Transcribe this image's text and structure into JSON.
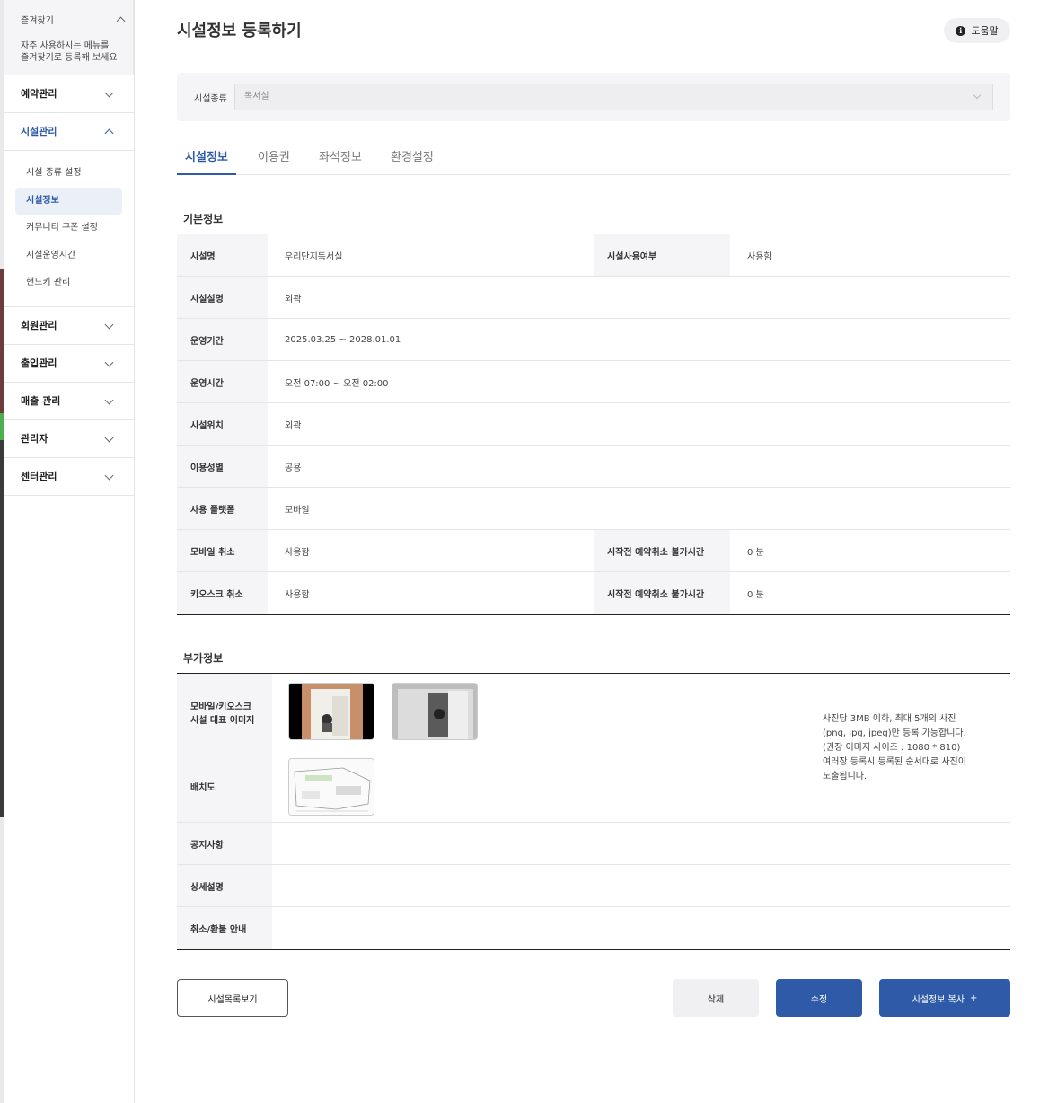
{
  "sidebar": {
    "favorites": {
      "title": "즐겨찾기",
      "desc_line1": "자주 사용하시는 메뉴를",
      "desc_line2": "즐겨찾기로 등록해 보세요!"
    },
    "menus": [
      {
        "label": "예약관리"
      },
      {
        "label": "시설관리"
      },
      {
        "label": "회원관리"
      },
      {
        "label": "출입관리"
      },
      {
        "label": "매출 관리"
      },
      {
        "label": "관리자"
      },
      {
        "label": "센터관리"
      }
    ],
    "submenu": [
      {
        "label": "시설 종류 설정"
      },
      {
        "label": "시설정보"
      },
      {
        "label": "커뮤니티 쿠폰 설정"
      },
      {
        "label": "시설운영시간"
      },
      {
        "label": "핸드키 관리"
      }
    ]
  },
  "header": {
    "title": "시설정보 등록하기",
    "help_label": "도움말"
  },
  "facility_type": {
    "label": "시설종류",
    "value": "독서실"
  },
  "tabs": [
    {
      "label": "시설정보"
    },
    {
      "label": "이용권"
    },
    {
      "label": "좌석정보"
    },
    {
      "label": "환경설정"
    }
  ],
  "basic": {
    "title": "기본정보",
    "name_label": "시설명",
    "name_value": "우리단지독서실",
    "use_label": "시설사용여부",
    "use_value": "사용함",
    "desc_label": "시설설명",
    "desc_value": "외곽",
    "period_label": "운영기간",
    "period_value": "2025.03.25 ~ 2028.01.01",
    "hours_label": "운영시간",
    "hours_value": "오전 07:00 ~ 오전 02:00",
    "location_label": "시설위치",
    "location_value": "외곽",
    "gender_label": "이용성별",
    "gender_value": "공용",
    "platform_label": "사용 플랫폼",
    "platform_value": "모바일",
    "mobile_cancel_label": "모바일 취소",
    "mobile_cancel_value": "사용함",
    "mobile_block_label": "시작전 예약취소 불가시간",
    "mobile_block_value": "0 분",
    "kiosk_cancel_label": "키오스크 취소",
    "kiosk_cancel_value": "사용함",
    "kiosk_block_label": "시작전 예약취소 불가시간",
    "kiosk_block_value": "0 분"
  },
  "extra": {
    "title": "부가정보",
    "image_label_line1": "모바일/키오스크",
    "image_label_line2": "시설 대표 이미지",
    "layout_label": "배치도",
    "note_line1": "사진당 3MB 이하, 최대 5개의 사진",
    "note_line2": "(png, jpg, jpeg)만 등록 가능합니다.",
    "note_line3": "(권장 이미지 사이즈 : 1080 * 810)",
    "note_line4": "여러장 등록시 등록된 순서대로 사진이",
    "note_line5": "노출됩니다.",
    "notice_label": "공지사항",
    "detail_label": "상세설명",
    "refund_label": "취소/환불 안내"
  },
  "actions": {
    "list_label": "시설목록보기",
    "delete_label": "삭제",
    "edit_label": "수정",
    "copy_label": "시설정보 복사",
    "copy_icon": "+"
  },
  "colors": {
    "accent": "#2f5aa8",
    "panel": "#f5f5f7"
  }
}
